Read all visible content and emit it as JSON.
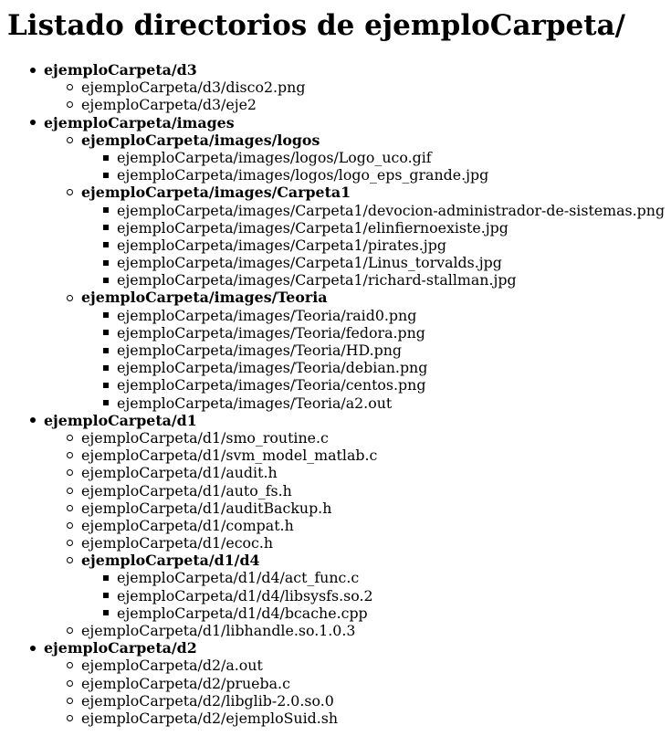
{
  "page": {
    "title": "Listado directorios de ejemploCarpeta/"
  },
  "tree": [
    {
      "level": 0,
      "kind": "dir",
      "label": "ejemploCarpeta/d3"
    },
    {
      "level": 1,
      "kind": "file",
      "label": "ejemploCarpeta/d3/disco2.png"
    },
    {
      "level": 1,
      "kind": "file",
      "label": "ejemploCarpeta/d3/eje2"
    },
    {
      "level": 0,
      "kind": "dir",
      "label": "ejemploCarpeta/images"
    },
    {
      "level": 1,
      "kind": "dir",
      "label": "ejemploCarpeta/images/logos"
    },
    {
      "level": 2,
      "kind": "file",
      "label": "ejemploCarpeta/images/logos/Logo_uco.gif"
    },
    {
      "level": 2,
      "kind": "file",
      "label": "ejemploCarpeta/images/logos/logo_eps_grande.jpg"
    },
    {
      "level": 1,
      "kind": "dir",
      "label": "ejemploCarpeta/images/Carpeta1"
    },
    {
      "level": 2,
      "kind": "file",
      "label": "ejemploCarpeta/images/Carpeta1/devocion-administrador-de-sistemas.png"
    },
    {
      "level": 2,
      "kind": "file",
      "label": "ejemploCarpeta/images/Carpeta1/elinfiernoexiste.jpg"
    },
    {
      "level": 2,
      "kind": "file",
      "label": "ejemploCarpeta/images/Carpeta1/pirates.jpg"
    },
    {
      "level": 2,
      "kind": "file",
      "label": "ejemploCarpeta/images/Carpeta1/Linus_torvalds.jpg"
    },
    {
      "level": 2,
      "kind": "file",
      "label": "ejemploCarpeta/images/Carpeta1/richard-stallman.jpg"
    },
    {
      "level": 1,
      "kind": "dir",
      "label": "ejemploCarpeta/images/Teoria"
    },
    {
      "level": 2,
      "kind": "file",
      "label": "ejemploCarpeta/images/Teoria/raid0.png"
    },
    {
      "level": 2,
      "kind": "file",
      "label": "ejemploCarpeta/images/Teoria/fedora.png"
    },
    {
      "level": 2,
      "kind": "file",
      "label": "ejemploCarpeta/images/Teoria/HD.png"
    },
    {
      "level": 2,
      "kind": "file",
      "label": "ejemploCarpeta/images/Teoria/debian.png"
    },
    {
      "level": 2,
      "kind": "file",
      "label": "ejemploCarpeta/images/Teoria/centos.png"
    },
    {
      "level": 2,
      "kind": "file",
      "label": "ejemploCarpeta/images/Teoria/a2.out"
    },
    {
      "level": 0,
      "kind": "dir",
      "label": "ejemploCarpeta/d1"
    },
    {
      "level": 1,
      "kind": "file",
      "label": "ejemploCarpeta/d1/smo_routine.c"
    },
    {
      "level": 1,
      "kind": "file",
      "label": "ejemploCarpeta/d1/svm_model_matlab.c"
    },
    {
      "level": 1,
      "kind": "file",
      "label": "ejemploCarpeta/d1/audit.h"
    },
    {
      "level": 1,
      "kind": "file",
      "label": "ejemploCarpeta/d1/auto_fs.h"
    },
    {
      "level": 1,
      "kind": "file",
      "label": "ejemploCarpeta/d1/auditBackup.h"
    },
    {
      "level": 1,
      "kind": "file",
      "label": "ejemploCarpeta/d1/compat.h"
    },
    {
      "level": 1,
      "kind": "file",
      "label": "ejemploCarpeta/d1/ecoc.h"
    },
    {
      "level": 1,
      "kind": "dir",
      "label": "ejemploCarpeta/d1/d4"
    },
    {
      "level": 2,
      "kind": "file",
      "label": "ejemploCarpeta/d1/d4/act_func.c"
    },
    {
      "level": 2,
      "kind": "file",
      "label": "ejemploCarpeta/d1/d4/libsysfs.so.2"
    },
    {
      "level": 2,
      "kind": "file",
      "label": "ejemploCarpeta/d1/d4/bcache.cpp"
    },
    {
      "level": 1,
      "kind": "file",
      "label": "ejemploCarpeta/d1/libhandle.so.1.0.3"
    },
    {
      "level": 0,
      "kind": "dir",
      "label": "ejemploCarpeta/d2"
    },
    {
      "level": 1,
      "kind": "file",
      "label": "ejemploCarpeta/d2/a.out"
    },
    {
      "level": 1,
      "kind": "file",
      "label": "ejemploCarpeta/d2/prueba.c"
    },
    {
      "level": 1,
      "kind": "file",
      "label": "ejemploCarpeta/d2/libglib-2.0.so.0"
    },
    {
      "level": 1,
      "kind": "file",
      "label": "ejemploCarpeta/d2/ejemploSuid.sh"
    }
  ]
}
